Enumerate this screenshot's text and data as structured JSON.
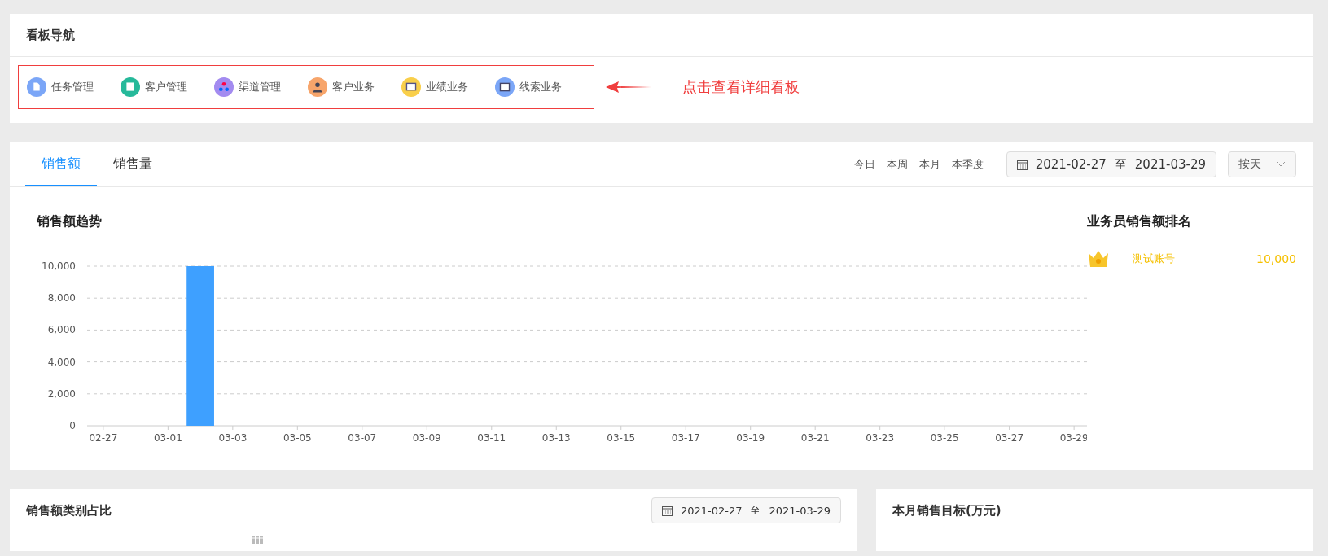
{
  "nav_panel": {
    "title": "看板导航",
    "items": [
      {
        "label": "任务管理",
        "kind": "doc",
        "color": "#7ba6f7"
      },
      {
        "label": "客户管理",
        "kind": "clipboard",
        "color": "#26b99a"
      },
      {
        "label": "渠道管理",
        "kind": "network",
        "color": "#a38bf0"
      },
      {
        "label": "客户业务",
        "kind": "person",
        "color": "#f7a56b"
      },
      {
        "label": "业绩业务",
        "kind": "monitor",
        "color": "#f9cf4a"
      },
      {
        "label": "线索业务",
        "kind": "window",
        "color": "#7ba6f7"
      }
    ],
    "annotation": "点击查看详细看板"
  },
  "sales_panel": {
    "tabs": [
      {
        "label": "销售额",
        "selected": true
      },
      {
        "label": "销售量",
        "selected": false
      }
    ],
    "periods": [
      "今日",
      "本周",
      "本月",
      "本季度"
    ],
    "date_range": {
      "start": "2021-02-27",
      "separator": "至",
      "end": "2021-03-29"
    },
    "granularity": "按天",
    "chart_title": "销售额趋势",
    "chart_data": {
      "type": "bar",
      "grid": true,
      "categories": [
        "02-27",
        null,
        "03-01",
        null,
        "03-03",
        null,
        "03-05",
        null,
        "03-07",
        null,
        "03-09",
        null,
        "03-11",
        null,
        "03-13",
        null,
        "03-15",
        null,
        "03-17",
        null,
        "03-19",
        null,
        "03-21",
        null,
        "03-23",
        null,
        "03-25",
        null,
        "03-27",
        null,
        "03-29"
      ],
      "series": [
        {
          "color": "#3ea0ff",
          "values": [
            0,
            0,
            0,
            10000,
            0,
            0,
            0,
            0,
            0,
            0,
            0,
            0,
            0,
            0,
            0,
            0,
            0,
            0,
            0,
            0,
            0,
            0,
            0,
            0,
            0,
            0,
            0,
            0,
            0,
            0,
            0
          ]
        }
      ],
      "ylim": [
        0,
        10000
      ],
      "yticks": [
        {
          "value": 0,
          "label": "0"
        },
        {
          "value": 2000,
          "label": "2,000"
        },
        {
          "value": 4000,
          "label": "4,000"
        },
        {
          "value": 6000,
          "label": "6,000"
        },
        {
          "value": 8000,
          "label": "8,000"
        },
        {
          "value": 10000,
          "label": "10,000"
        }
      ]
    },
    "ranking": {
      "title": "业务员销售额排名",
      "rows": [
        {
          "name": "测试账号",
          "value": "10,000"
        }
      ]
    }
  },
  "category_panel": {
    "title": "销售额类别占比",
    "date_range": {
      "start": "2021-02-27",
      "separator": "至",
      "end": "2021-03-29"
    }
  },
  "target_panel": {
    "title": "本月销售目标(万元)"
  }
}
